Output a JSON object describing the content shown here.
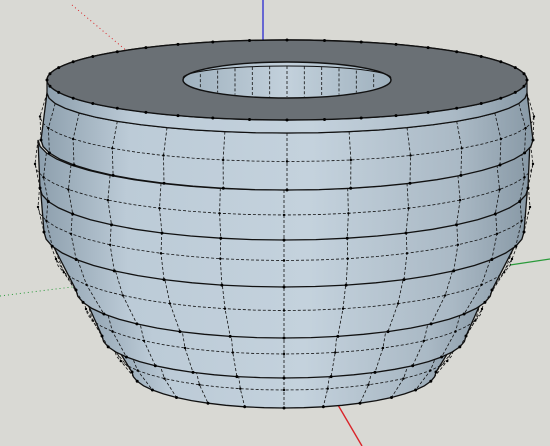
{
  "viewport": {
    "background": "#d9d9d4"
  },
  "axes": {
    "x_color": "#d9252a",
    "y_color": "#2a9a3a",
    "z_color": "#1c1cd2"
  },
  "model": {
    "face_color": "#b9cad6",
    "face_dark": "#8fa3b2",
    "top_color": "#6a7075",
    "edge_color": "#111111",
    "hidden_edge_color": "#222222",
    "vertex_color": "#000000"
  }
}
